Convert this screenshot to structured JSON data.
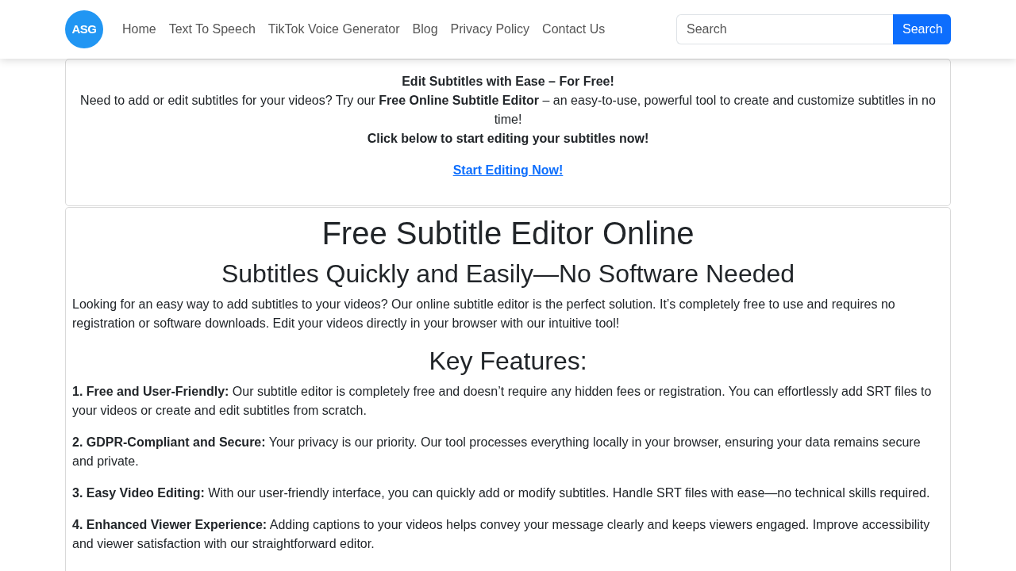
{
  "header": {
    "logo_text": "ASG",
    "nav": [
      "Home",
      "Text To Speech",
      "TikTok Voice Generator",
      "Blog",
      "Privacy Policy",
      "Contact Us"
    ],
    "search": {
      "placeholder": "Search",
      "button": "Search"
    }
  },
  "promo": {
    "title": "Edit Subtitles with Ease – For Free!",
    "text": "Need to add or edit subtitles for your videos? Try our **Free Online Subtitle Editor** – an easy-to-use, powerful tool to create and customize subtitles in no time!",
    "call_to_action": "Click below to start editing your subtitles now!",
    "link": "Start Editing Now!"
  },
  "article": {
    "title": "Free Subtitle Editor Online",
    "subtitle": "Subtitles Quickly and Easily—No Software Needed",
    "intro": "Looking for an easy way to add subtitles to your videos? Our online subtitle editor is the perfect solution. It’s completely free to use and requires no registration or software downloads. Edit your videos directly in your browser with our intuitive tool!",
    "features_heading": "Key Features:",
    "features": [
      "**1. Free and User-Friendly:** Our subtitle editor is completely free and doesn’t require any hidden fees or registration. You can effortlessly add SRT files to your videos or create and edit subtitles from scratch.",
      "**2. GDPR-Compliant and Secure:** Your privacy is our priority. Our tool processes everything locally in your browser, ensuring your data remains secure and private.",
      "**3. Easy Video Editing:** With our user-friendly interface, you can quickly add or modify subtitles. Handle SRT files with ease—no technical skills required.",
      "**4. Enhanced Viewer Experience:** Adding captions to your videos helps convey your message clearly and keeps viewers engaged. Improve accessibility and viewer satisfaction with our straightforward editor."
    ]
  }
}
